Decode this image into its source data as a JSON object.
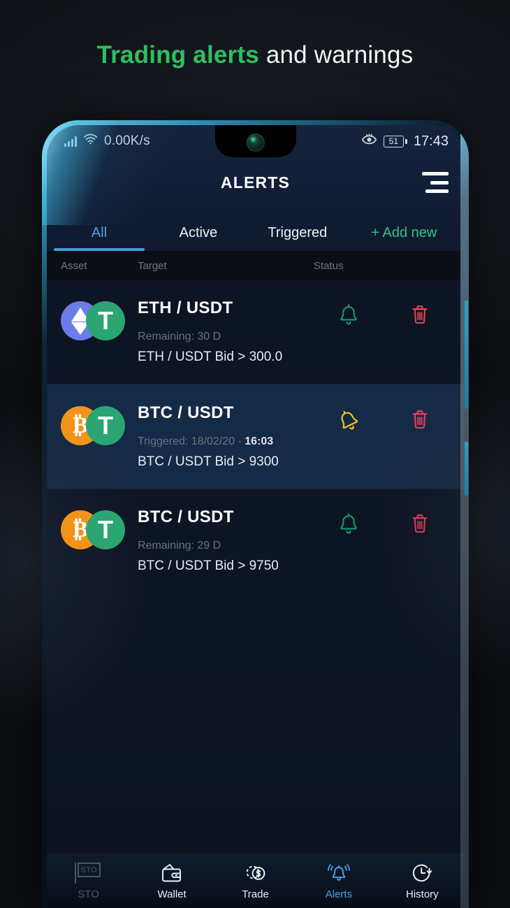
{
  "headline": {
    "green_part": "Trading alerts",
    "white_part": " and warnings"
  },
  "status_bar": {
    "network_speed": "0.00K/s",
    "battery_level": "51",
    "time": "17:43",
    "icons": [
      "signal-bars-icon",
      "wifi-icon",
      "eye-icon",
      "battery-icon"
    ]
  },
  "app_bar": {
    "title": "ALERTS",
    "menu_icon": "hamburger-menu-icon"
  },
  "tabs": [
    {
      "label": "All",
      "active": true
    },
    {
      "label": "Active",
      "active": false
    },
    {
      "label": "Triggered",
      "active": false
    },
    {
      "label": "+ Add new",
      "active": false
    }
  ],
  "column_headers": {
    "asset": "Asset",
    "target": "Target",
    "status": "Status"
  },
  "alerts": [
    {
      "pair": "ETH / USDT",
      "coin_left": "ETH",
      "coin_right": "USDT",
      "sub_label": "Remaining: 30 D",
      "sub_time": "",
      "condition": "ETH / USDT Bid > 300.0",
      "status_icon": "bell-icon",
      "status_state": "active",
      "delete_icon": "trash-icon",
      "highlighted": false
    },
    {
      "pair": "BTC / USDT",
      "coin_left": "BTC",
      "coin_right": "USDT",
      "sub_label": "Triggered: 18/02/20 - ",
      "sub_time": "16:03",
      "condition": "BTC / USDT Bid > 9300",
      "status_icon": "bell-ringing-icon",
      "status_state": "triggered",
      "delete_icon": "trash-icon",
      "highlighted": true
    },
    {
      "pair": "BTC / USDT",
      "coin_left": "BTC",
      "coin_right": "USDT",
      "sub_label": "Remaining: 29 D",
      "sub_time": "",
      "condition": "BTC / USDT Bid > 9750",
      "status_icon": "bell-icon",
      "status_state": "active",
      "delete_icon": "trash-icon",
      "highlighted": false
    }
  ],
  "bottom_nav": [
    {
      "label": "STO",
      "icon": "sto-flag-icon",
      "state": "disabled"
    },
    {
      "label": "Wallet",
      "icon": "wallet-icon",
      "state": "normal"
    },
    {
      "label": "Trade",
      "icon": "coins-dollar-icon",
      "state": "normal"
    },
    {
      "label": "Alerts",
      "icon": "bell-ringing-icon",
      "state": "active"
    },
    {
      "label": "History",
      "icon": "clock-arrow-icon",
      "state": "normal"
    }
  ],
  "colors": {
    "accent_green": "#2fbf60",
    "tab_active_blue": "#4aa8e0",
    "add_new_green": "#2fc38a",
    "bell_active_green": "#0f9e6e",
    "bell_triggered_yellow": "#f5c518",
    "trash_red": "#e8415a",
    "eth_blue": "#6b7ce8",
    "btc_orange": "#f2941a",
    "usdt_green": "#2ba572",
    "nav_active_blue": "#4aa3e2",
    "row_highlight": "#152a46"
  }
}
